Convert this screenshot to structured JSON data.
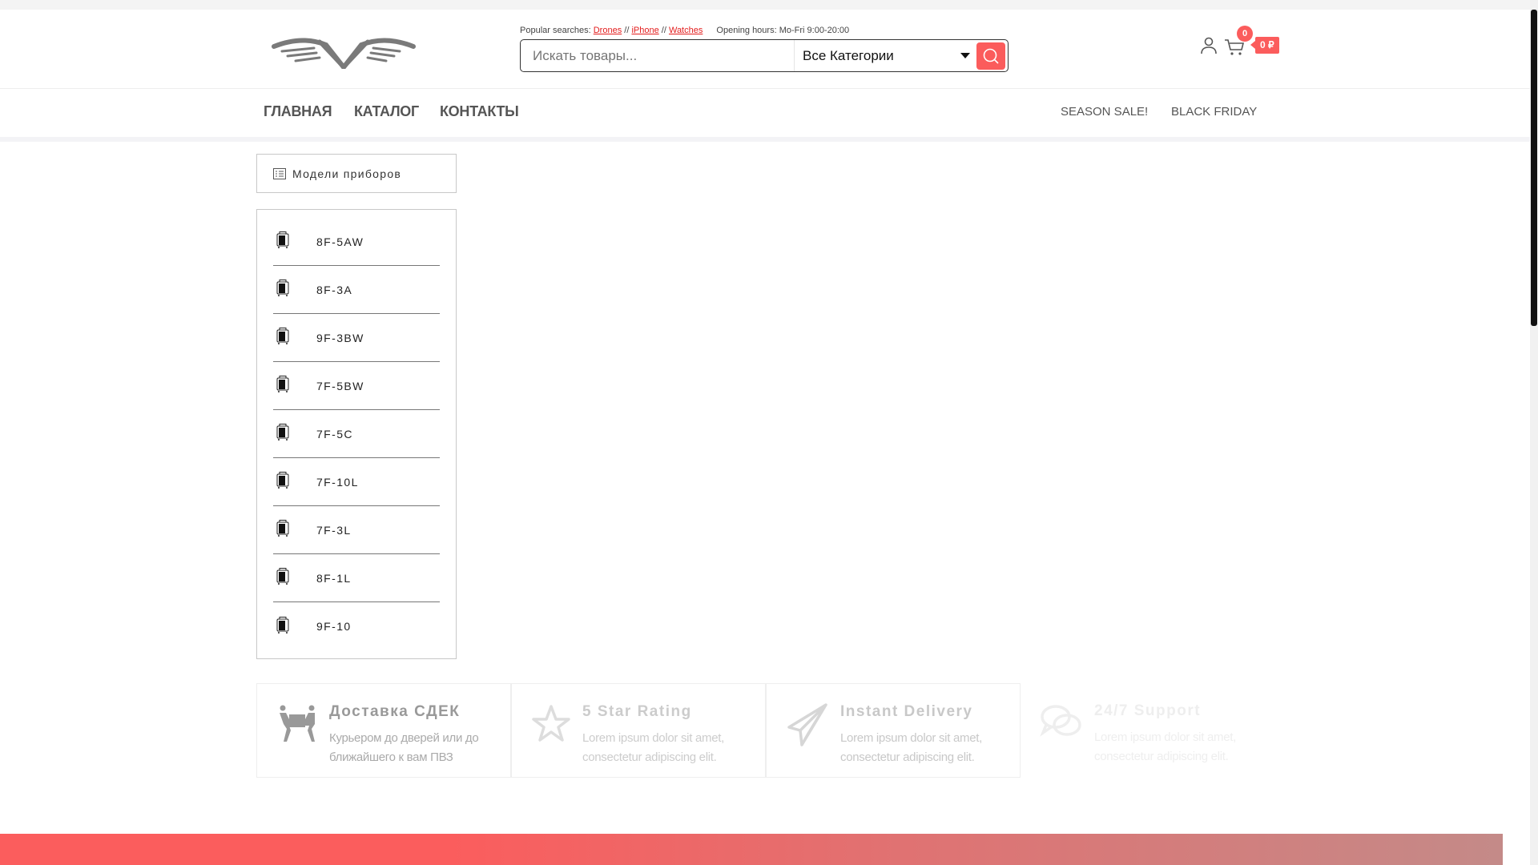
{
  "header": {
    "popular_label": "Popular searches:",
    "popular_links": [
      "Drones",
      "iPhone",
      "Watches"
    ],
    "separator": "//",
    "opening_hours": "Opening hours: Mo-Fri 9:00-20:00",
    "search_placeholder": "Искать товары...",
    "category_selected": "Все Категории",
    "cart_count": "0",
    "cart_total": "0 ₽"
  },
  "nav": {
    "main": [
      "ГЛАВНАЯ",
      "КАТАЛОГ",
      "КОНТАКТЫ"
    ],
    "right": [
      "SEASON SALE!",
      "BLACK FRIDAY"
    ]
  },
  "sidebar": {
    "title": "Модели приборов",
    "items": [
      "8F-5AW",
      "8F-3A",
      "9F-3BW",
      "7F-5BW",
      "7F-5C",
      "7F-10L",
      "7F-3L",
      "8F-1L",
      "9F-10"
    ]
  },
  "features": [
    {
      "title": "Доставка СДЕК",
      "text": "Курьером до дверей или до ближайшего к вам ПВЗ",
      "icon": "movers-icon"
    },
    {
      "title": "5 Star Rating",
      "text": "Lorem ipsum dolor sit amet, consectetur adipiscing elit.",
      "icon": "star-icon"
    },
    {
      "title": "Instant Delivery",
      "text": "Lorem ipsum dolor sit amet, consectetur adipiscing elit.",
      "icon": "paper-plane-icon"
    },
    {
      "title": "24/7 Support",
      "text": "Lorem ipsum dolor sit amet, consectetur adipiscing elit.",
      "icon": "chat-icon"
    }
  ],
  "colors": {
    "accent": "#fb5c5c"
  }
}
